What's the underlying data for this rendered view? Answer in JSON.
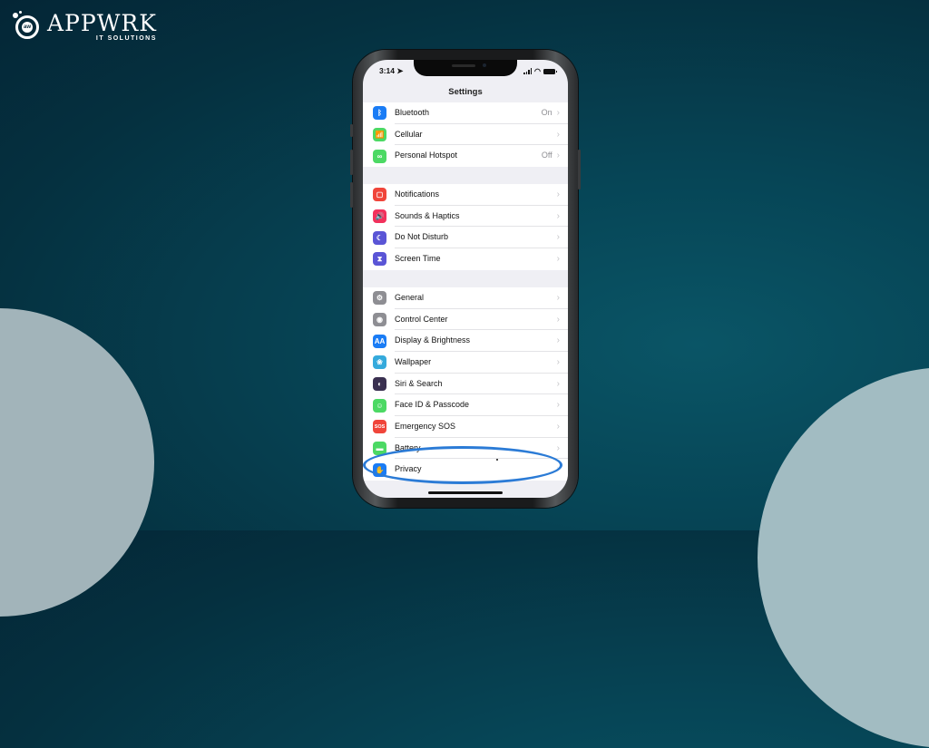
{
  "brand": {
    "name": "APPWRK",
    "tagline": "IT SOLUTIONS",
    "mark_text": "aw"
  },
  "colors": {
    "background": "#05303f",
    "accent_highlight": "#2b7bd6",
    "blob": "#a2b4ba"
  },
  "phone": {
    "status_bar": {
      "time": "3:14",
      "location_icon": "location-arrow-icon",
      "icons": [
        "signal-icon",
        "wifi-icon",
        "battery-icon"
      ]
    },
    "nav_title": "Settings",
    "groups": [
      {
        "items": [
          {
            "label": "Bluetooth",
            "value": "On",
            "icon": "bluetooth-icon",
            "color": "#1a7cf5",
            "glyph": "ᛒ"
          },
          {
            "label": "Cellular",
            "value": "",
            "icon": "cellular-icon",
            "color": "#4cd964",
            "glyph": "📶"
          },
          {
            "label": "Personal Hotspot",
            "value": "Off",
            "icon": "hotspot-icon",
            "color": "#4cd964",
            "glyph": "∞"
          }
        ]
      },
      {
        "items": [
          {
            "label": "Notifications",
            "value": "",
            "icon": "notifications-icon",
            "color": "#f0453a",
            "glyph": "▢"
          },
          {
            "label": "Sounds & Haptics",
            "value": "",
            "icon": "sounds-icon",
            "color": "#f2315c",
            "glyph": "🔊"
          },
          {
            "label": "Do Not Disturb",
            "value": "",
            "icon": "moon-icon",
            "color": "#5a55d6",
            "glyph": "☾"
          },
          {
            "label": "Screen Time",
            "value": "",
            "icon": "hourglass-icon",
            "color": "#5a55d6",
            "glyph": "⧗"
          }
        ]
      },
      {
        "items": [
          {
            "label": "General",
            "value": "",
            "icon": "gear-icon",
            "color": "#8e8e93",
            "glyph": "⚙"
          },
          {
            "label": "Control Center",
            "value": "",
            "icon": "control-center-icon",
            "color": "#8e8e93",
            "glyph": "◉"
          },
          {
            "label": "Display & Brightness",
            "value": "",
            "icon": "display-icon",
            "color": "#1a7cf5",
            "glyph": "AA"
          },
          {
            "label": "Wallpaper",
            "value": "",
            "icon": "wallpaper-icon",
            "color": "#35aadc",
            "glyph": "❀"
          },
          {
            "label": "Siri & Search",
            "value": "",
            "icon": "siri-icon",
            "color": "#3a3050",
            "glyph": "◐"
          },
          {
            "label": "Face ID & Passcode",
            "value": "",
            "icon": "face-id-icon",
            "color": "#4cd964",
            "glyph": "☺"
          },
          {
            "label": "Emergency SOS",
            "value": "",
            "icon": "sos-icon",
            "color": "#f0453a",
            "glyph": "SOS"
          },
          {
            "label": "Battery",
            "value": "",
            "icon": "battery-setting-icon",
            "color": "#4cd964",
            "glyph": "▬"
          },
          {
            "label": "Privacy",
            "value": "",
            "icon": "hand-icon",
            "color": "#1a7cf5",
            "glyph": "✋"
          }
        ]
      }
    ]
  }
}
